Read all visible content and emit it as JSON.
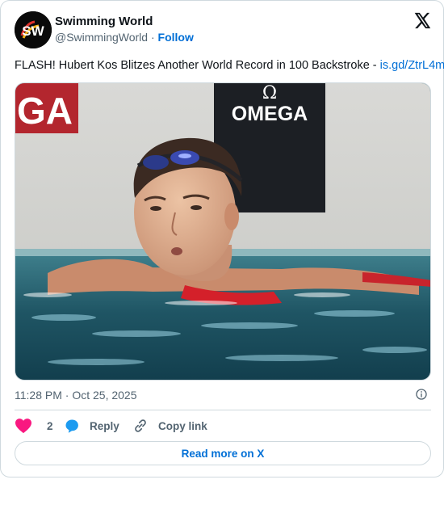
{
  "account": {
    "display_name": "Swimming World",
    "handle": "@SwimmingWorld",
    "separator": "·",
    "follow_label": "Follow",
    "avatar_letters": "SW"
  },
  "tweet": {
    "text": "FLASH! Hubert Kos Blitzes Another World Record in 100 Backstroke - ",
    "link_text": "is.gd/ZtrL4m",
    "timestamp": "11:28 PM · Oct 25, 2025"
  },
  "media": {
    "banner_left_text": "GA",
    "banner_right_text": "OMEGA"
  },
  "actions": {
    "like_count": "2",
    "reply_label": "Reply",
    "copy_label": "Copy link",
    "read_more_label": "Read more on X"
  },
  "colors": {
    "link": "#006fd6",
    "muted": "#536471",
    "border": "#cfd9de",
    "like": "#f91880",
    "reply": "#1d9bf0"
  },
  "icons": [
    "x-logo-icon",
    "info-icon",
    "heart-icon",
    "reply-bubble-icon",
    "link-icon"
  ]
}
